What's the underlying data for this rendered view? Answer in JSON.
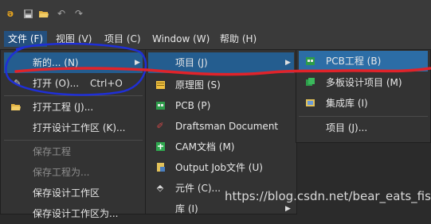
{
  "toolbar": {
    "icons": [
      "app-logo-icon",
      "save-icon",
      "open-folder-icon",
      "undo-icon",
      "redo-icon"
    ]
  },
  "menubar": {
    "items": [
      {
        "label": "文件 (F)"
      },
      {
        "label": "视图 (V)"
      },
      {
        "label": "项目 (C)"
      },
      {
        "label": "Window (W)"
      },
      {
        "label": "帮助 (H)"
      }
    ]
  },
  "file_menu": {
    "items": [
      {
        "label": "新的... (N)",
        "shortcut": "",
        "submenu": true
      },
      {
        "label": "打开 (O)...",
        "shortcut": "Ctrl+O"
      },
      {
        "label": "打开工程 (J)..."
      },
      {
        "label": "打开设计工作区 (K)..."
      },
      {
        "label": "保存工程"
      },
      {
        "label": "保存工程为..."
      },
      {
        "label": "保存设计工作区"
      },
      {
        "label": "保存设计工作区为..."
      }
    ]
  },
  "new_submenu": {
    "items": [
      {
        "label": "项目 (J)"
      },
      {
        "label": "原理图 (S)"
      },
      {
        "label": "PCB (P)"
      },
      {
        "label": "Draftsman Document"
      },
      {
        "label": "CAM文档 (M)"
      },
      {
        "label": "Output Job文件 (U)"
      },
      {
        "label": "元件 (C)..."
      },
      {
        "label": "库 (I)"
      }
    ]
  },
  "project_submenu": {
    "items": [
      {
        "label": "PCB工程 (B)"
      },
      {
        "label": "多板设计项目 (M)"
      },
      {
        "label": "集成库 (I)"
      },
      {
        "label": "项目 (J)..."
      }
    ]
  },
  "watermark": "https://blog.csdn.net/bear_eats_fish",
  "colors": {
    "menu_bg": "#333333",
    "highlight": "#245d8f",
    "annotation_blue": "#1f2fd6",
    "annotation_red": "#e0232a"
  }
}
